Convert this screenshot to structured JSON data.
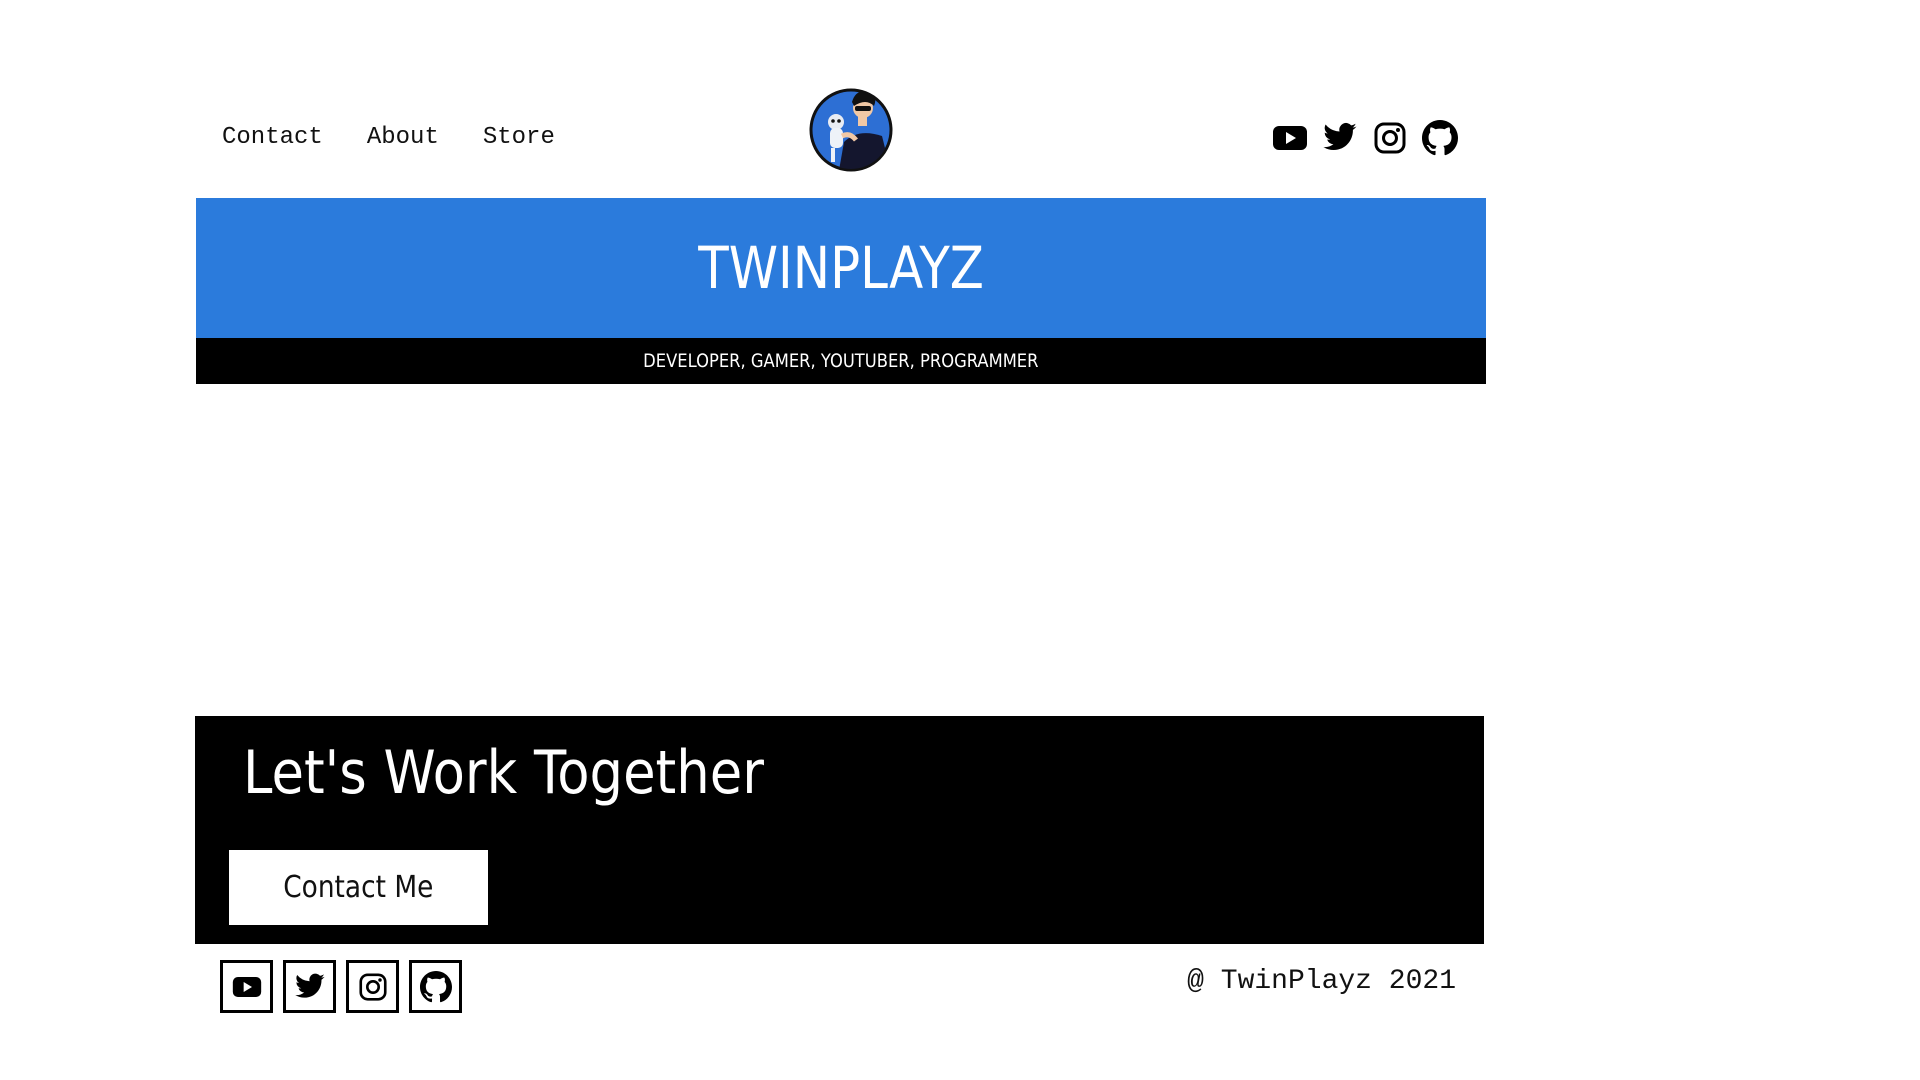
{
  "nav": {
    "links": [
      "Contact",
      "About",
      "Store"
    ]
  },
  "logo": {
    "icon": "avatar-logo",
    "ring_color": "#2d6fd4"
  },
  "social": {
    "icons": [
      "youtube-icon",
      "twitter-icon",
      "instagram-icon",
      "github-icon"
    ]
  },
  "hero": {
    "title": "TWINPLAYZ",
    "tagline": "DEVELOPER, GAMER, YOUTUBER, PROGRAMMER",
    "background": "#2b7bdc"
  },
  "cta": {
    "title": "Let's Work Together",
    "button_label": "Contact Me"
  },
  "footer": {
    "copyright": "@ TwinPlayz 2021"
  }
}
